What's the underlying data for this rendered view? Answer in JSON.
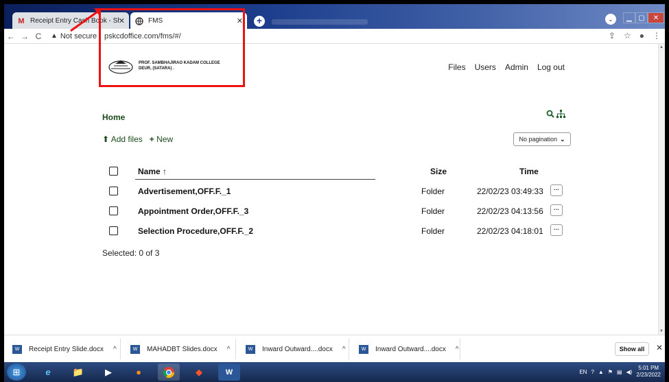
{
  "browser": {
    "tabs": [
      {
        "title": "Receipt Entry Cash Book - Sheda",
        "icon": "gmail-icon",
        "active": false
      },
      {
        "title": "FMS",
        "icon": "globe-icon",
        "active": true
      }
    ],
    "new_tab_symbol": "+",
    "url_security": "Not secure",
    "url": "pskcdoffice.com/fms/#/"
  },
  "header": {
    "college_name_line1": "PROF. SAMBHAJIRAO KADAM COLLEGE",
    "college_name_line2": "DEUR, (SATARA) .",
    "nav": [
      "Files",
      "Users",
      "Admin",
      "Log out"
    ]
  },
  "breadcrumb": "Home",
  "actions": {
    "add_files": "Add files",
    "new": "New"
  },
  "pagination_label": "No pagination",
  "table": {
    "columns": {
      "name": "Name",
      "size": "Size",
      "time": "Time"
    },
    "sort_indicator": "↑",
    "rows": [
      {
        "name": "Advertisement,OFF.F._1",
        "size": "Folder",
        "time": "22/02/23 03:49:33"
      },
      {
        "name": "Appointment Order,OFF.F._3",
        "size": "Folder",
        "time": "22/02/23 04:13:56"
      },
      {
        "name": "Selection Procedure,OFF.F._2",
        "size": "Folder",
        "time": "22/02/23 04:18:01"
      }
    ]
  },
  "selection_status": "Selected: 0 of 3",
  "downloads": {
    "items": [
      "Receipt Entry Slide.docx",
      "MAHADBT Slides.docx",
      "Inward Outward....docx",
      "Inward Outward....docx"
    ],
    "show_all": "Show all"
  },
  "taskbar": {
    "language": "EN",
    "time": "5:01 PM",
    "date": "2/23/2022"
  },
  "colors": {
    "accent_green": "#1d5e2a",
    "highlight_red": "#e11111"
  }
}
